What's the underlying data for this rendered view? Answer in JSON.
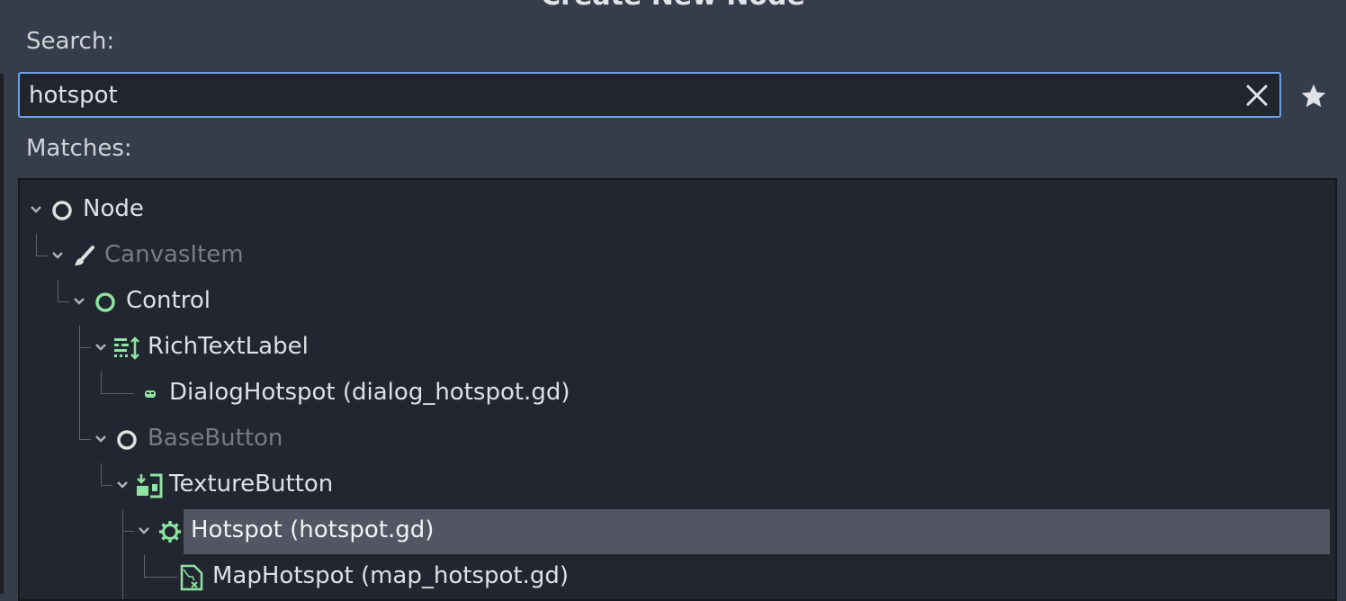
{
  "dialog": {
    "title": "Create New Node"
  },
  "search": {
    "label": "Search:",
    "value": "hotspot"
  },
  "matches": {
    "label": "Matches:"
  },
  "tree": {
    "items": [
      {
        "label": "Node",
        "icon": "node-circle-icon",
        "dim": false
      },
      {
        "label": "CanvasItem",
        "icon": "brush-icon",
        "dim": true
      },
      {
        "label": "Control",
        "icon": "control-circle-icon",
        "dim": false
      },
      {
        "label": "RichTextLabel",
        "icon": "rich-text-icon",
        "dim": false
      },
      {
        "label": "DialogHotspot (dialog_hotspot.gd)",
        "icon": "dialog-hotspot-icon",
        "dim": false
      },
      {
        "label": "BaseButton",
        "icon": "base-button-circle-icon",
        "dim": true
      },
      {
        "label": "TextureButton",
        "icon": "texture-button-icon",
        "dim": false
      },
      {
        "label": "Hotspot (hotspot.gd)",
        "icon": "gear-icon",
        "dim": false,
        "selected": true
      },
      {
        "label": "MapHotspot (map_hotspot.gd)",
        "icon": "map-hotspot-icon",
        "dim": false
      }
    ]
  },
  "colors": {
    "background": "#363d4a",
    "panel": "#222631",
    "accent": "#6f9ee6",
    "selected": "#525662",
    "icon_green": "#8ee3a0",
    "icon_white": "#e0e0e0"
  }
}
